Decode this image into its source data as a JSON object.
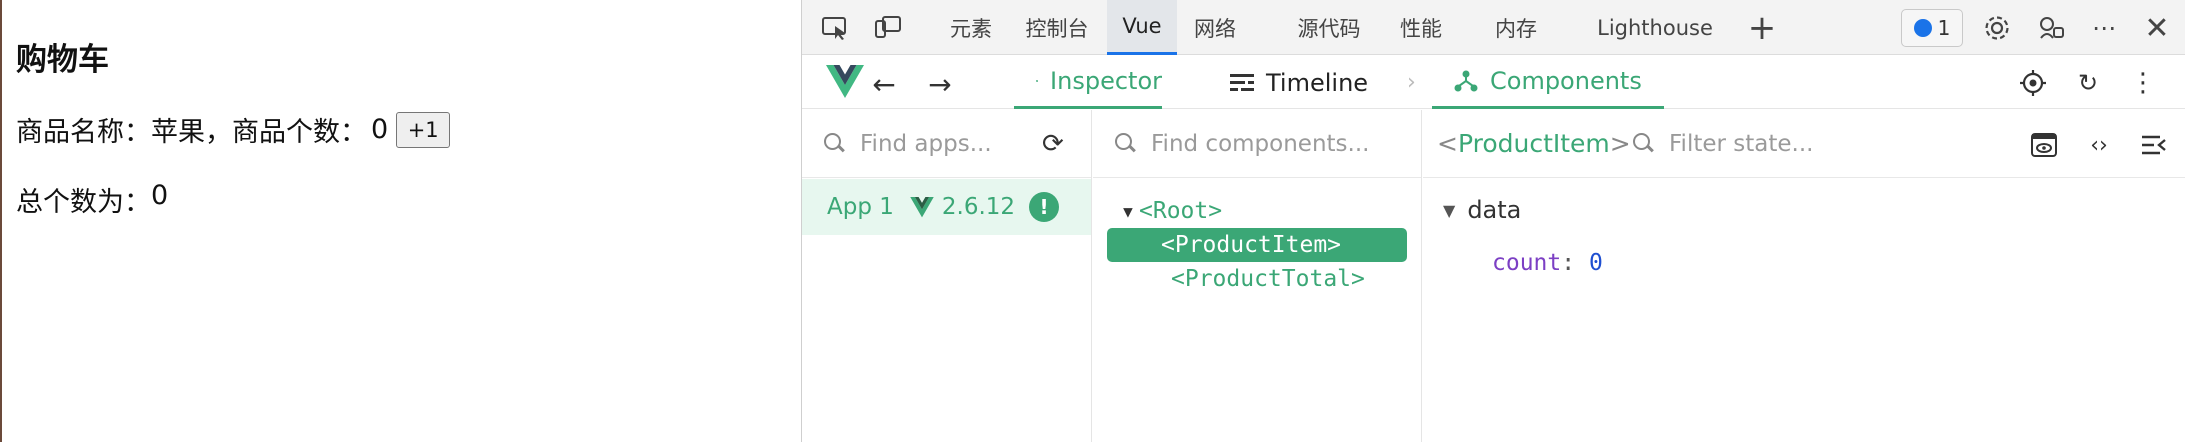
{
  "page": {
    "title": "购物车",
    "product_label": "商品名称：苹果，商品个数：",
    "product_count": "0",
    "increment_button": "+1",
    "total_label": "总个数为：",
    "total_value": "0"
  },
  "devtools": {
    "tabs": [
      "元素",
      "控制台",
      "Vue",
      "网络",
      "源代码",
      "性能",
      "内存",
      "Lighthouse"
    ],
    "active_tab": "Vue",
    "issues_count": "1"
  },
  "vue": {
    "tabs": {
      "inspector": "Inspector",
      "timeline": "Timeline",
      "components": "Components"
    },
    "apps_search_placeholder": "Find apps...",
    "components_search_placeholder": "Find components...",
    "state_search_placeholder": "Filter state...",
    "app": {
      "name": "App 1",
      "version": "2.6.12"
    },
    "tree": [
      {
        "label": "<Root>",
        "selected": false
      },
      {
        "label": "<ProductItem>",
        "selected": true
      },
      {
        "label": "<ProductTotal>",
        "selected": false
      }
    ],
    "selected_component": "ProductItem",
    "state_section": "data",
    "state": [
      {
        "key": "count",
        "value": "0"
      }
    ]
  },
  "colors": {
    "vue_green": "#3ba776",
    "accent_blue": "#1a73e8",
    "state_key": "#7c3fc4",
    "state_value": "#1f4fd1"
  }
}
